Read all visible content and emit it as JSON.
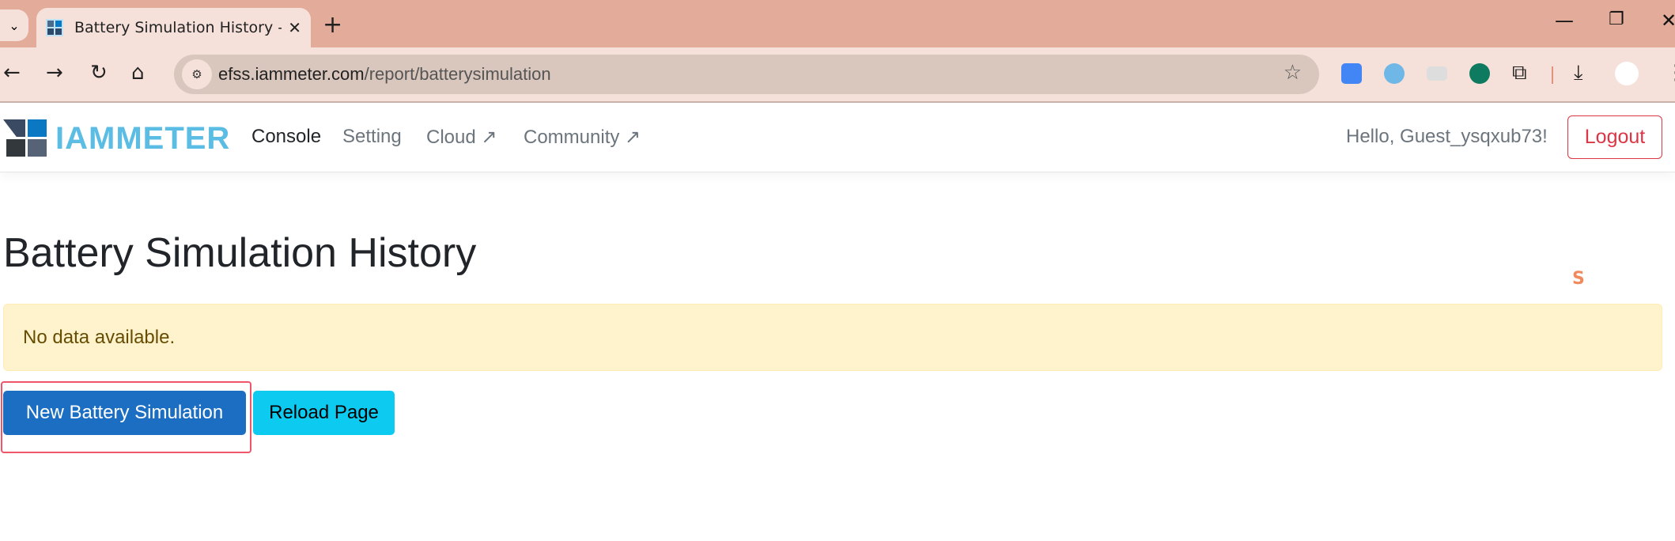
{
  "browser": {
    "tab_title": "Battery Simulation History - IAMMETER",
    "url_host": "efss.iammeter.com",
    "url_path": "/report/batterysimulation",
    "icons": [
      "tab-list-icon",
      "close-icon",
      "plus-icon",
      "minimize-icon",
      "restore-icon",
      "window-close-icon",
      "back-icon",
      "forward-icon",
      "reload-icon",
      "home-icon",
      "site-settings-icon",
      "star-icon",
      "google-translate-icon",
      "extension-v-icon",
      "extension-screen-icon",
      "grammarly-icon",
      "puzzle-icon",
      "download-icon",
      "profile-avatar",
      "more-icon"
    ]
  },
  "navbar": {
    "brand": "IAMMETER",
    "links": [
      {
        "label": "Console"
      },
      {
        "label": "Setting"
      },
      {
        "label": "Cloud"
      },
      {
        "label": "Community"
      }
    ],
    "greeting": "Hello, Guest_ysqxub73!",
    "logout": "Logout"
  },
  "main": {
    "title": "Battery Simulation History",
    "alert": "No data available.",
    "new_button": "New Battery Simulation",
    "reload_button": "Reload Page"
  },
  "colors": {
    "primary": "#1b6ec2",
    "info": "#0dcaf0",
    "danger": "#dc3545",
    "warning_bg": "#fff3cd",
    "brand": "#5bbde4"
  }
}
